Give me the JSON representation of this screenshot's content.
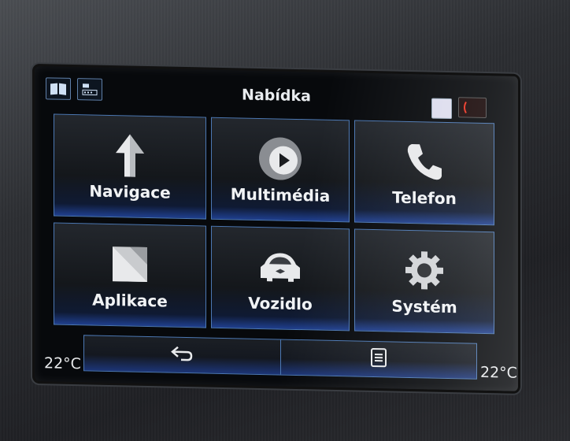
{
  "header": {
    "title": "Nabídka"
  },
  "tiles": [
    {
      "label": "Navigace",
      "icon": "navigation-arrow-icon"
    },
    {
      "label": "Multimédia",
      "icon": "play-icon"
    },
    {
      "label": "Telefon",
      "icon": "phone-icon"
    },
    {
      "label": "Aplikace",
      "icon": "apps-icon"
    },
    {
      "label": "Vozidlo",
      "icon": "car-icon"
    },
    {
      "label": "Systém",
      "icon": "gear-icon"
    }
  ],
  "bottom_bar": {
    "back": "back-icon",
    "menu": "list-icon"
  },
  "climate": {
    "left_temp": "22°C",
    "right_temp": "22°C"
  },
  "colors": {
    "accent": "#4c78b3",
    "tile_glow": "#1f3f8e"
  }
}
